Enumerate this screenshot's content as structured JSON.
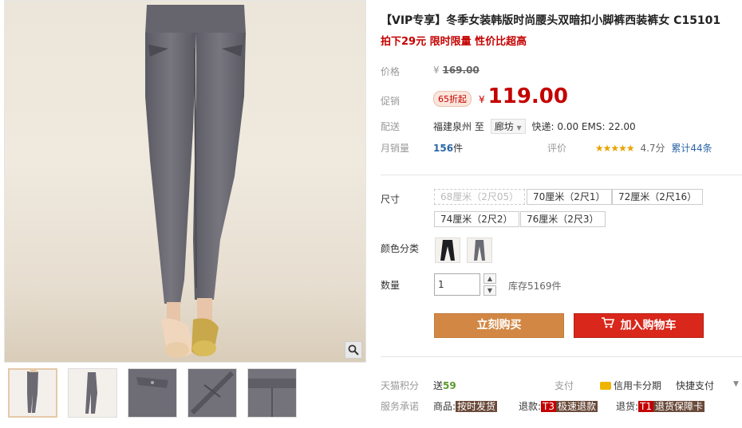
{
  "product": {
    "title": "【VIP专享】冬季女装韩版时尚腰头双暗扣小脚裤西装裤女 C15101",
    "subtitle": "拍下29元 限时限量 性价比超高"
  },
  "price": {
    "orig_label": "价格",
    "currency": "¥",
    "orig_value": "169.00",
    "promo_label": "促销",
    "promo_badge": "65折起",
    "promo_value": "119.00"
  },
  "shipping": {
    "label": "配送",
    "from": "福建泉州",
    "to_word": "至",
    "to": "廊坊",
    "fee": "快递: 0.00 EMS: 22.00"
  },
  "sales": {
    "label": "月销量",
    "count": "156",
    "unit": "件",
    "rating_label": "评价",
    "stars": "★★★★★",
    "score": "4.7分",
    "total": "累计44条"
  },
  "sku": {
    "size_label": "尺寸",
    "sizes": [
      "68厘米（2尺05）",
      "70厘米（2尺1）",
      "72厘米（2尺16）",
      "74厘米（2尺2）",
      "76厘米（2尺3）"
    ],
    "color_label": "颜色分类",
    "qty_label": "数量",
    "qty_value": "1",
    "stock": "库存5169件"
  },
  "actions": {
    "buy_now": "立刻购买",
    "add_cart": "加入购物车"
  },
  "points": {
    "label": "天猫积分",
    "value_prefix": "送",
    "value": "59",
    "pay_label": "支付",
    "credit": "信用卡分期",
    "fast_pay": "快捷支付"
  },
  "service": {
    "label": "服务承诺",
    "goods": "商品:",
    "goods_tag": "按时发货",
    "refund": "退款:",
    "refund_t": "T3",
    "refund_tag": "极速退款",
    "return": "退货:",
    "return_t": "T1",
    "return_tag": "退货保障卡"
  },
  "colors": {
    "price_red": "#c40000",
    "buy_orange": "#d28844",
    "cart_red": "#d9271b",
    "pants_gray": "#6b6a73"
  }
}
